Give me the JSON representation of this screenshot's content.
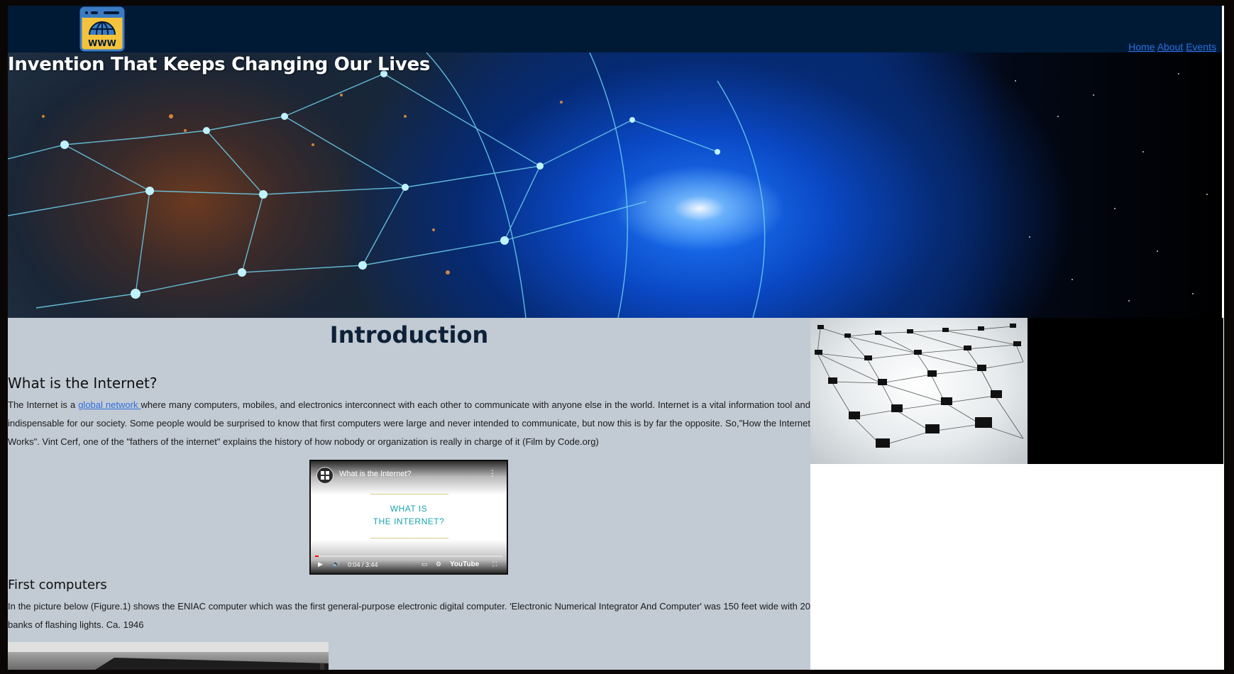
{
  "header": {
    "logo_text": "WWW",
    "nav": [
      "Home",
      "About",
      "Events"
    ]
  },
  "hero": {
    "title": "Invention That Keeps Changing Our Lives"
  },
  "main": {
    "intro_heading": "Introduction",
    "section1": {
      "heading": "What is the Internet?",
      "text_before_link": "The Internet is a ",
      "link": "global network ",
      "text_after_link": "where many computers, mobiles, and electronics interconnect with each other to communicate with anyone else in the world. Internet is a vital information tool and indispensable for our society. Some people would be surprised to know that first computers were large and never intended to communicate, but now this is by far the opposite. So,\"How the Internet Works\". Vint Cerf, one of the \"fathers of the internet\" explains the history of how nobody or organization is really in charge of it (Film by Code.org)"
    },
    "video": {
      "title": "What is the Internet?",
      "center_text": "WHAT IS\nTHE INTERNET?",
      "time": "0:04 / 3:44",
      "brand": "YouTube",
      "progress": 0.018
    },
    "section2": {
      "heading": "First computers",
      "text": "In the picture below (Figure.1) shows the ENIAC computer which was the first general-purpose electronic digital computer. 'Electronic Numerical Integrator And Computer' was 150 feet wide with 20 banks of flashing lights. Ca. 1946"
    }
  },
  "colors": {
    "header_bg": "#001a36",
    "main_bg": "#c2cad3",
    "link": "#2f6fe0",
    "heading": "#0d2138"
  }
}
